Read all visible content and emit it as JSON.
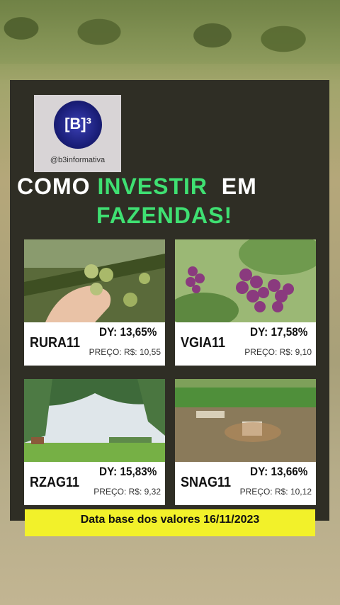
{
  "brand": {
    "logo_text": "[B]³",
    "handle": "@b3informativa"
  },
  "title": {
    "line1_part1": "COMO",
    "line1_part2": "INVESTIR",
    "line1_part3": "EM",
    "line2": "FAZENDAS!"
  },
  "colors": {
    "accent_green": "#3fe072",
    "panel": "#2f2e25",
    "footer_yellow": "#f2f12a"
  },
  "funds": [
    {
      "ticker": "RURA11",
      "dy": "DY: 13,65%",
      "preco": "PREÇO: R$: 10,55",
      "image": "olives"
    },
    {
      "ticker": "VGIA11",
      "dy": "DY: 17,58%",
      "preco": "PREÇO: R$: 9,10",
      "image": "grapes"
    },
    {
      "ticker": "RZAG11",
      "dy": "DY: 15,83%",
      "preco": "PREÇO: R$: 9,32",
      "image": "farm-trees"
    },
    {
      "ticker": "SNAG11",
      "dy": "DY: 13,66%",
      "preco": "PREÇO: R$: 10,12",
      "image": "field-aerial"
    }
  ],
  "footer": {
    "text": "Data base dos valores 16/11/2023"
  }
}
